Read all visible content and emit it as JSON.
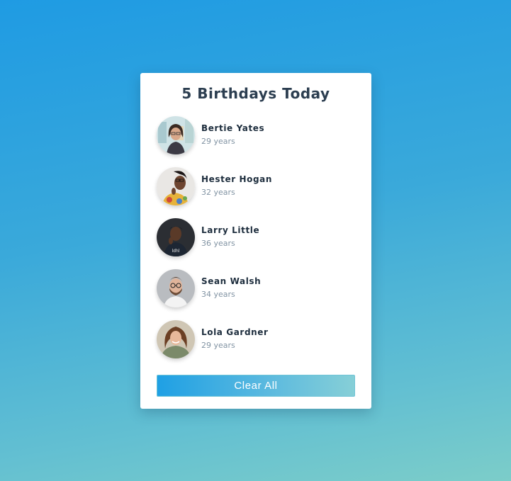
{
  "header": {
    "title": "5 Birthdays Today"
  },
  "people": [
    {
      "name": "Bertie Yates",
      "age": "29 years",
      "avatar": "avatar-woman-glasses-photo"
    },
    {
      "name": "Hester Hogan",
      "age": "32 years",
      "avatar": "avatar-woman-glasses-floral-photo"
    },
    {
      "name": "Larry Little",
      "age": "36 years",
      "avatar": "avatar-man-dark-shirt-photo"
    },
    {
      "name": "Sean Walsh",
      "age": "34 years",
      "avatar": "avatar-man-glasses-beard-photo"
    },
    {
      "name": "Lola Gardner",
      "age": "29 years",
      "avatar": "avatar-woman-curly-hair-photo"
    }
  ],
  "actions": {
    "clear_label": "Clear All"
  },
  "colors": {
    "background_top": "#1f9be3",
    "background_bottom": "#7ccdc9",
    "button_start": "#1fa0e4",
    "button_end": "#86cfd7",
    "name_text": "#1d2d3d",
    "age_text": "#8193a3"
  }
}
